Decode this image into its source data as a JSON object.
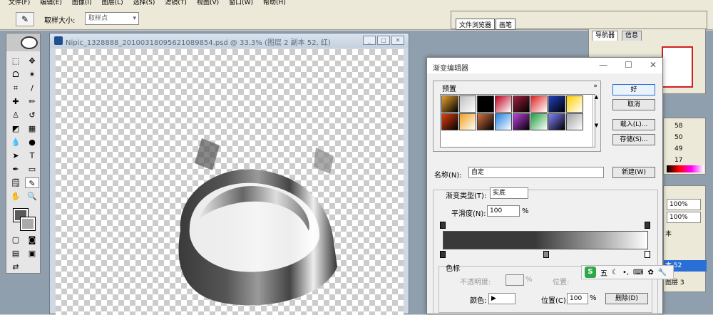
{
  "menu": {
    "items": [
      "文件(F)",
      "编辑(E)",
      "图像(I)",
      "图层(L)",
      "选择(S)",
      "滤镜(T)",
      "视图(V)",
      "窗口(W)",
      "帮助(H)"
    ]
  },
  "options": {
    "sample_label": "取样大小:",
    "sample_value": "取样点"
  },
  "well": {
    "tab1": "文件浏览器",
    "tab2": "画笔"
  },
  "document": {
    "title": "Nipic_1328888_20100318095621089854.psd @ 33.3% (图层 2 副本 52, 红)"
  },
  "navigator": {
    "tab_nav": "导航器",
    "tab_info": "信息"
  },
  "color_panel": {
    "values": [
      "58",
      "50",
      "49",
      "17"
    ]
  },
  "layers_panel": {
    "opacity1": "100%",
    "opacity2": "100%",
    "row_suffix1": "本",
    "row_selected": "本 52",
    "row_suffix2": "图层 3"
  },
  "gradient_editor": {
    "title": "渐变编辑器",
    "presets_label": "预置",
    "more": "»",
    "ok": "好",
    "cancel": "取消",
    "load": "载入(L)...",
    "save": "存储(S)...",
    "name_label": "名称(N):",
    "name_value": "自定",
    "new_button": "新建(W)",
    "type_label": "渐变类型(T):",
    "type_value": "实底",
    "smooth_label": "平滑度(N):",
    "smooth_value": "100",
    "smooth_unit": "%",
    "stops_label": "色标",
    "opacity_label": "不透明度:",
    "opacity_unit": "%",
    "location_label": "位置:",
    "delete_label": "删除(D)",
    "color_label": "颜色:",
    "location2_label": "位置(C):",
    "location2_value": "100",
    "location2_unit": "%",
    "delete2_label": "删除(D)"
  },
  "ime": {
    "label": "五"
  },
  "colors": {
    "accent": "#2a6fd6",
    "swatches": [
      "#e8a030",
      "#c0c0c0",
      "#000000",
      "#c00020",
      "#a02040",
      "#e02020",
      "#2040c0",
      "#ffd000",
      "#e04010",
      "#f0a020",
      "#d07040",
      "#2080e0",
      "#c040e0",
      "#20a040",
      "#8080ff",
      "#a0a0a0"
    ]
  }
}
